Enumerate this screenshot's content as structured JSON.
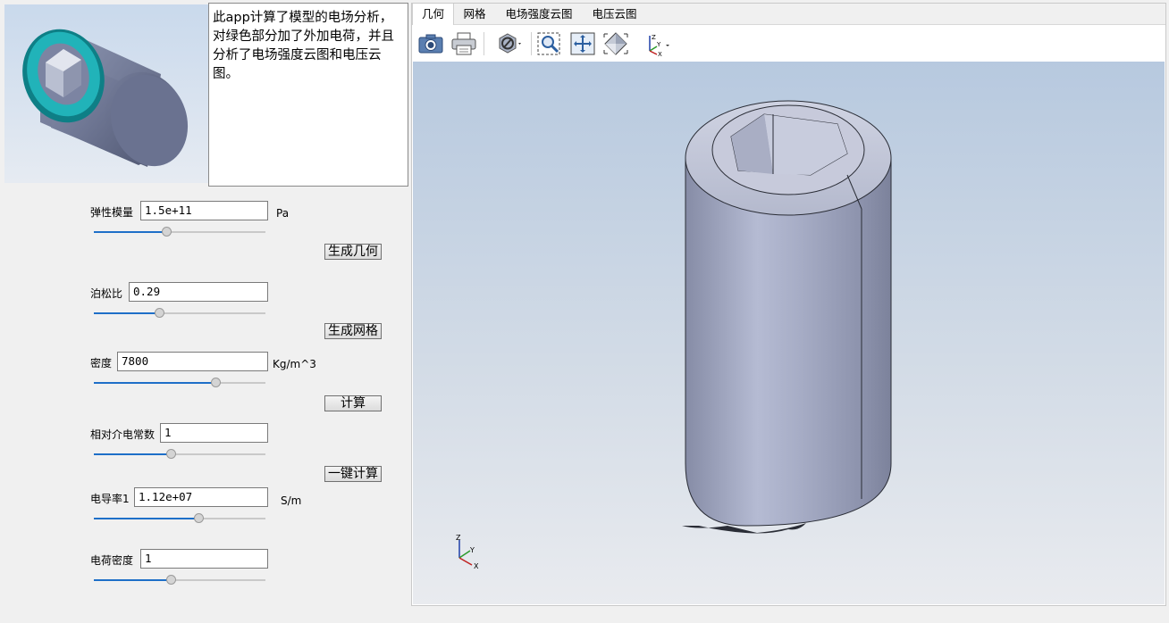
{
  "description": "此app计算了模型的电场分析，对绿色部分加了外加电荷，并且分析了电场强度云图和电压云图。",
  "params": [
    {
      "label": "弹性模量",
      "value": "1.5e+11",
      "unit": "Pa",
      "slider": 0.42
    },
    {
      "label": "泊松比",
      "value": "0.29",
      "unit": "",
      "slider": 0.38
    },
    {
      "label": "密度",
      "value": "7800",
      "unit": "Kg/m^3",
      "slider": 0.71
    },
    {
      "label": "相对介电常数",
      "value": "1",
      "unit": "",
      "slider": 0.45
    },
    {
      "label": "电导率1",
      "value": "1.12e+07",
      "unit": "S/m",
      "slider": 0.61
    },
    {
      "label": "电荷密度",
      "value": "1",
      "unit": "",
      "slider": 0.45
    }
  ],
  "buttons": {
    "gen_geometry": "生成几何",
    "gen_mesh": "生成网格",
    "compute": "计算",
    "one_click": "一键计算"
  },
  "tabs": [
    "几何",
    "网格",
    "电场强度云图",
    "电压云图"
  ],
  "active_tab": "几何",
  "toolbar_icons": [
    "camera-icon",
    "print-icon",
    "hide-icon",
    "zoom-box-icon",
    "zoom-extents-icon",
    "view-orientation-icon",
    "axis-triad-icon"
  ],
  "triad": {
    "z": "Z",
    "y": "Y",
    "x": "X"
  },
  "colors": {
    "accent": "#1e6fc8",
    "teal": "#19a6ad",
    "model": "#a5aec8"
  }
}
